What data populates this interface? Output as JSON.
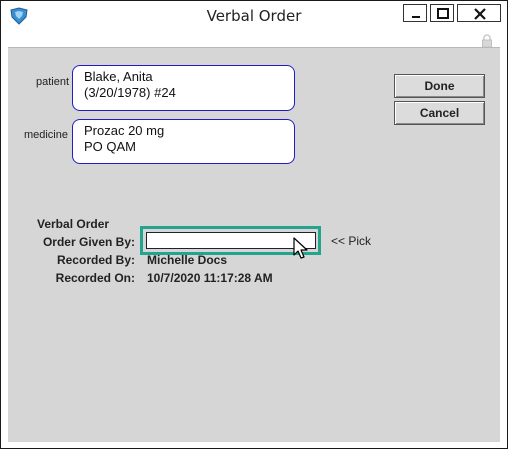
{
  "window": {
    "title": "Verbal Order",
    "minimize_icon": "minimize-icon",
    "maximize_icon": "maximize-icon",
    "close_icon": "close-icon",
    "app_icon": "app-shield-icon",
    "lock_icon": "lock-icon"
  },
  "patient": {
    "label": "patient",
    "line1": "Blake, Anita",
    "line2": "(3/20/1978) #24"
  },
  "medicine": {
    "label": "medicine",
    "line1": "Prozac 20 mg",
    "line2": "PO QAM"
  },
  "buttons": {
    "done": "Done",
    "cancel": "Cancel"
  },
  "verbal_order": {
    "section_title": "Verbal Order",
    "given_by_label": "Order Given By:",
    "given_by_value": "",
    "pick_label": "<< Pick",
    "recorded_by_label": "Recorded By:",
    "recorded_by_value": "Michelle Docs",
    "recorded_on_label": "Recorded On:",
    "recorded_on_value": "10/7/2020 11:17:28 AM"
  },
  "colors": {
    "field_border": "#1e1ec8",
    "highlight": "#22a58c",
    "client_bg": "#d6d6d6"
  }
}
